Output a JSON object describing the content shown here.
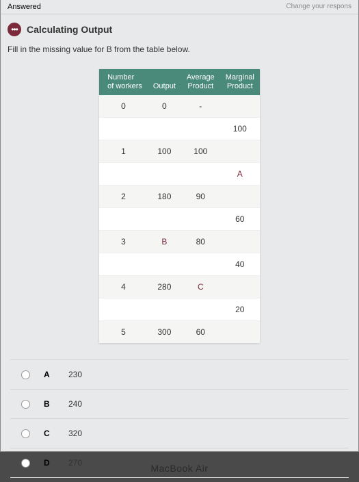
{
  "topbar": {
    "left": "Answered",
    "right": "Change your respons"
  },
  "header": {
    "icon_label": "•••",
    "title": "Calculating Output"
  },
  "instruction": "Fill in the missing value for B from the table below.",
  "table": {
    "headers": {
      "col1a": "Number",
      "col1b": "of workers",
      "col2": "Output",
      "col3a": "Average",
      "col3b": "Product",
      "col4a": "Marginal",
      "col4b": "Product"
    },
    "rows": [
      {
        "workers": "0",
        "output": "0",
        "avg": "-",
        "marg": ""
      },
      {
        "workers": "",
        "output": "",
        "avg": "",
        "marg": "100"
      },
      {
        "workers": "1",
        "output": "100",
        "avg": "100",
        "marg": ""
      },
      {
        "workers": "",
        "output": "",
        "avg": "",
        "marg": "A",
        "marg_letter": true
      },
      {
        "workers": "2",
        "output": "180",
        "avg": "90",
        "marg": ""
      },
      {
        "workers": "",
        "output": "",
        "avg": "",
        "marg": "60"
      },
      {
        "workers": "3",
        "output": "B",
        "output_letter": true,
        "avg": "80",
        "marg": ""
      },
      {
        "workers": "",
        "output": "",
        "avg": "",
        "marg": "40"
      },
      {
        "workers": "4",
        "output": "280",
        "avg": "C",
        "avg_letter": true,
        "marg": ""
      },
      {
        "workers": "",
        "output": "",
        "avg": "",
        "marg": "20"
      },
      {
        "workers": "5",
        "output": "300",
        "avg": "60",
        "marg": ""
      }
    ]
  },
  "options": [
    {
      "letter": "A",
      "value": "230"
    },
    {
      "letter": "B",
      "value": "240"
    },
    {
      "letter": "C",
      "value": "320"
    },
    {
      "letter": "D",
      "value": "270"
    }
  ],
  "device_label": "MacBook Air"
}
